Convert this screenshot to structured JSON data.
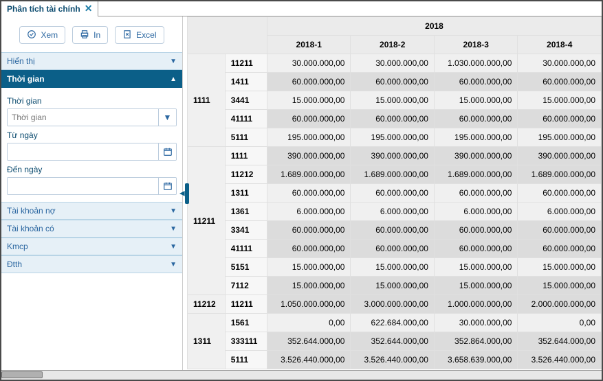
{
  "tab": {
    "title": "Phân tích tài chính"
  },
  "toolbar": {
    "view": "Xem",
    "print": "In",
    "excel": "Excel"
  },
  "panels": {
    "display": "Hiển thị",
    "time": "Thời gian",
    "debit": "Tài khoản nợ",
    "credit": "Tài khoản có",
    "kmcp": "Kmcp",
    "dtth": "Đtth"
  },
  "timePanel": {
    "periodLabel": "Thời gian",
    "periodPlaceholder": "Thời gian",
    "fromLabel": "Từ ngày",
    "toLabel": "Đến ngày"
  },
  "grid": {
    "yearHeader": "2018",
    "columns": [
      "2018-1",
      "2018-2",
      "2018-3",
      "2018-4"
    ],
    "groups": [
      {
        "code": "1111",
        "rows": [
          {
            "code": "11211",
            "vals": [
              "30.000.000,00",
              "30.000.000,00",
              "1.030.000.000,00",
              "30.000.000,00"
            ],
            "light": true
          },
          {
            "code": "1411",
            "vals": [
              "60.000.000,00",
              "60.000.000,00",
              "60.000.000,00",
              "60.000.000,00"
            ]
          },
          {
            "code": "3441",
            "vals": [
              "15.000.000,00",
              "15.000.000,00",
              "15.000.000,00",
              "15.000.000,00"
            ],
            "light": true
          },
          {
            "code": "41111",
            "vals": [
              "60.000.000,00",
              "60.000.000,00",
              "60.000.000,00",
              "60.000.000,00"
            ]
          },
          {
            "code": "5111",
            "vals": [
              "195.000.000,00",
              "195.000.000,00",
              "195.000.000,00",
              "195.000.000,00"
            ],
            "light": true
          }
        ]
      },
      {
        "code": "11211",
        "rows": [
          {
            "code": "1111",
            "vals": [
              "390.000.000,00",
              "390.000.000,00",
              "390.000.000,00",
              "390.000.000,00"
            ]
          },
          {
            "code": "11212",
            "vals": [
              "1.689.000.000,00",
              "1.689.000.000,00",
              "1.689.000.000,00",
              "1.689.000.000,00"
            ]
          },
          {
            "code": "1311",
            "vals": [
              "60.000.000,00",
              "60.000.000,00",
              "60.000.000,00",
              "60.000.000,00"
            ],
            "light": true
          },
          {
            "code": "1361",
            "vals": [
              "6.000.000,00",
              "6.000.000,00",
              "6.000.000,00",
              "6.000.000,00"
            ],
            "light": true
          },
          {
            "code": "3341",
            "vals": [
              "60.000.000,00",
              "60.000.000,00",
              "60.000.000,00",
              "60.000.000,00"
            ]
          },
          {
            "code": "41111",
            "vals": [
              "60.000.000,00",
              "60.000.000,00",
              "60.000.000,00",
              "60.000.000,00"
            ]
          },
          {
            "code": "5151",
            "vals": [
              "15.000.000,00",
              "15.000.000,00",
              "15.000.000,00",
              "15.000.000,00"
            ],
            "light": true
          },
          {
            "code": "7112",
            "vals": [
              "15.000.000,00",
              "15.000.000,00",
              "15.000.000,00",
              "15.000.000,00"
            ]
          }
        ]
      },
      {
        "code": "11212",
        "rows": [
          {
            "code": "11211",
            "vals": [
              "1.050.000.000,00",
              "3.000.000.000,00",
              "1.000.000.000,00",
              "2.000.000.000,00"
            ]
          }
        ]
      },
      {
        "code": "1311",
        "rows": [
          {
            "code": "1561",
            "vals": [
              "0,00",
              "622.684.000,00",
              "30.000.000,00",
              "0,00"
            ],
            "light": true
          },
          {
            "code": "333111",
            "vals": [
              "352.644.000,00",
              "352.644.000,00",
              "352.864.000,00",
              "352.644.000,00"
            ]
          },
          {
            "code": "5111",
            "vals": [
              "3.526.440.000,00",
              "3.526.440.000,00",
              "3.658.639.000,00",
              "3.526.440.000,00"
            ]
          }
        ]
      }
    ]
  }
}
